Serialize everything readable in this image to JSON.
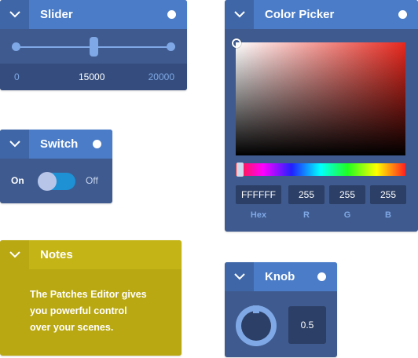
{
  "slider": {
    "title": "Slider",
    "min_label": "0",
    "value_label": "15000",
    "max_label": "20000",
    "value": 15000,
    "min": 0,
    "max": 20000
  },
  "switch": {
    "title": "Switch",
    "on_label": "On",
    "off_label": "Off",
    "state": "on"
  },
  "notes": {
    "title": "Notes",
    "text": "The Patches Editor gives\nyou powerful control\nover your  scenes."
  },
  "color_picker": {
    "title": "Color Picker",
    "hex": "FFFFFF",
    "r": "255",
    "g": "255",
    "b": "255",
    "hex_label": "Hex",
    "r_label": "R",
    "g_label": "G",
    "b_label": "B"
  },
  "knob": {
    "title": "Knob",
    "value": "0.5"
  },
  "colors": {
    "panel": "#3f5a8e",
    "header": "#4a7cc7",
    "accent": "#7fa8e6",
    "notes": "#b9a812",
    "switch_on": "#1e90d4"
  }
}
